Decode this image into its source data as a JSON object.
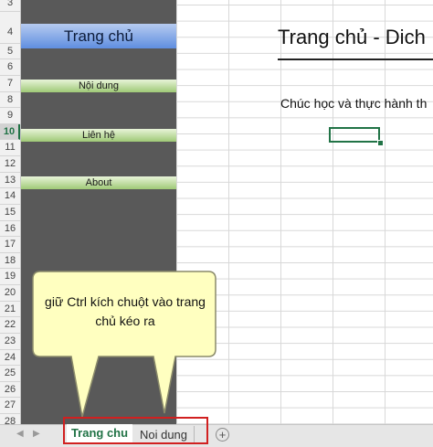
{
  "rows": [
    {
      "n": "3"
    },
    {
      "n": "4"
    },
    {
      "n": "5"
    },
    {
      "n": "6"
    },
    {
      "n": "7"
    },
    {
      "n": "8"
    },
    {
      "n": "9"
    },
    {
      "n": "10"
    },
    {
      "n": "11"
    },
    {
      "n": "12"
    },
    {
      "n": "13"
    },
    {
      "n": "14"
    },
    {
      "n": "15"
    },
    {
      "n": "16"
    },
    {
      "n": "17"
    },
    {
      "n": "18"
    },
    {
      "n": "19"
    },
    {
      "n": "20"
    },
    {
      "n": "21"
    },
    {
      "n": "22"
    },
    {
      "n": "23"
    },
    {
      "n": "24"
    },
    {
      "n": "25"
    },
    {
      "n": "26"
    },
    {
      "n": "27"
    },
    {
      "n": "28"
    }
  ],
  "active_row": "10",
  "sidebar": {
    "home_label": "Trang chủ",
    "nav": [
      {
        "label": "Nội dung"
      },
      {
        "label": "Liên hệ"
      },
      {
        "label": "About"
      }
    ]
  },
  "main": {
    "title": "Trang chủ - Dich",
    "greeting": "Chúc học và thực hành th"
  },
  "callout": {
    "text": "giữ Ctrl kích chuột vào trang chủ kéo ra"
  },
  "tabs": {
    "home": "Trang chu",
    "content": "Noi dung",
    "add": "+"
  },
  "colors": {
    "sidebar": "#595959",
    "accent": "#217346",
    "highlight_border": "#d12020",
    "callout_fill": "#ffffc0"
  }
}
